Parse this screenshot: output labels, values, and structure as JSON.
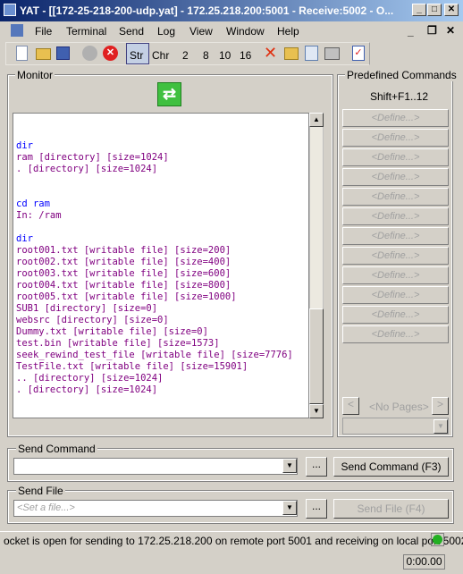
{
  "window": {
    "title": "YAT - [[172-25-218-200-udp.yat] - 172.25.218.200:5001 - Receive:5002 - O..."
  },
  "menu": [
    "File",
    "Terminal",
    "Send",
    "Log",
    "View",
    "Window",
    "Help"
  ],
  "toolbar": {
    "str": "Str",
    "chr": "Chr",
    "b2": "2",
    "b8": "8",
    "b10": "10",
    "b16": "16"
  },
  "monitor": {
    "label": "Monitor",
    "lines": [
      {
        "t": "",
        "k": "rx"
      },
      {
        "t": "",
        "k": "rx"
      },
      {
        "t": "dir",
        "k": "tx"
      },
      {
        "t": "ram [directory] [size=1024]",
        "k": "rx"
      },
      {
        "t": ". [directory] [size=1024]",
        "k": "rx"
      },
      {
        "t": "",
        "k": "rx"
      },
      {
        "t": "",
        "k": "rx"
      },
      {
        "t": "cd ram",
        "k": "tx"
      },
      {
        "t": "In: /ram",
        "k": "rx"
      },
      {
        "t": "",
        "k": "rx"
      },
      {
        "t": "dir",
        "k": "tx"
      },
      {
        "t": "root001.txt [writable file] [size=200]",
        "k": "rx"
      },
      {
        "t": "root002.txt [writable file] [size=400]",
        "k": "rx"
      },
      {
        "t": "root003.txt [writable file] [size=600]",
        "k": "rx"
      },
      {
        "t": "root004.txt [writable file] [size=800]",
        "k": "rx"
      },
      {
        "t": "root005.txt [writable file] [size=1000]",
        "k": "rx"
      },
      {
        "t": "SUB1 [directory] [size=0]",
        "k": "rx"
      },
      {
        "t": "websrc [directory] [size=0]",
        "k": "rx"
      },
      {
        "t": "Dummy.txt [writable file] [size=0]",
        "k": "rx"
      },
      {
        "t": "test.bin [writable file] [size=1573]",
        "k": "rx"
      },
      {
        "t": "seek_rewind_test_file [writable file] [size=7776]",
        "k": "rx"
      },
      {
        "t": "TestFile.txt [writable file] [size=15901]",
        "k": "rx"
      },
      {
        "t": ".. [directory] [size=1024]",
        "k": "rx"
      },
      {
        "t": ". [directory] [size=1024]",
        "k": "rx"
      }
    ]
  },
  "predefined": {
    "label": "Predefined Commands",
    "shortcut": "Shift+F1..12",
    "define": "<Define...>",
    "pages": "<No Pages>",
    "prev": "<",
    "next": ">"
  },
  "send_command": {
    "label": "Send Command",
    "value": "",
    "more": "...",
    "button": "Send Command (F3)"
  },
  "send_file": {
    "label": "Send File",
    "placeholder": "<Set a file...>",
    "more": "...",
    "button": "Send File (F4)"
  },
  "status": {
    "message": "ocket is open for sending to 172.25.218.200 on remote port 5001 and receiving on local port 5002",
    "time": "0:00.00",
    "led_color": "#22b022"
  },
  "colors": {
    "tx": "#0000ff",
    "rx": "#800080"
  }
}
